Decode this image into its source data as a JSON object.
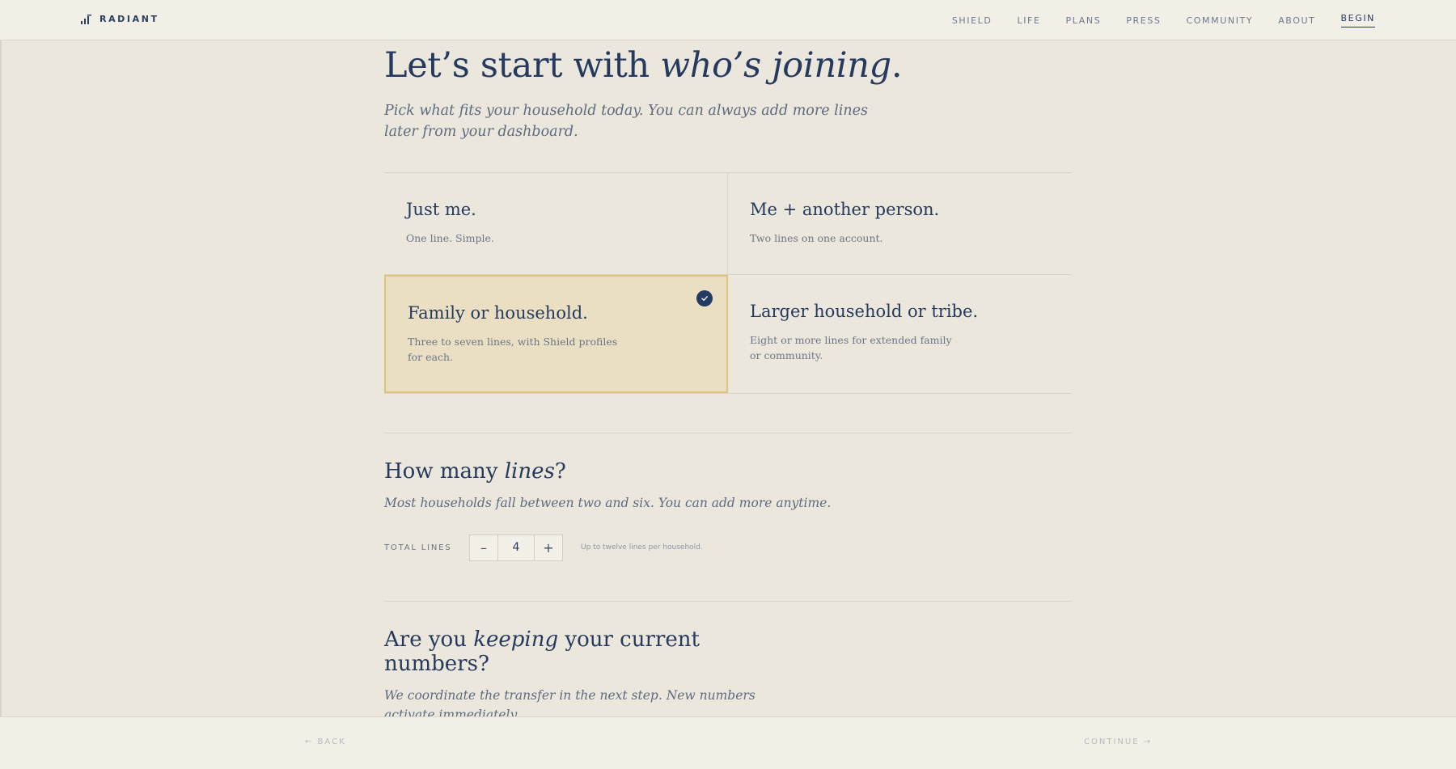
{
  "nav": {
    "brand": "RADIANT",
    "links": [
      "SHIELD",
      "LIFE",
      "PLANS",
      "PRESS",
      "COMMUNITY",
      "ABOUT"
    ],
    "begin": "BEGIN"
  },
  "hero": {
    "title_start": "Let’s start with ",
    "title_em": "who’s joining",
    "title_end": ".",
    "lede": "Pick what fits your household today. You can always add more lines later from your dashboard."
  },
  "options": [
    {
      "title": "Just me.",
      "desc": "One line. Simple.",
      "selected": false
    },
    {
      "title": "Me + another person.",
      "desc": "Two lines on one account.",
      "selected": false
    },
    {
      "title": "Family or household.",
      "desc": "Three to seven lines, with Shield profiles for each.",
      "selected": true
    },
    {
      "title": "Larger household or tribe.",
      "desc": "Eight or more lines for extended family or community.",
      "selected": false
    }
  ],
  "lines": {
    "title_start": "How many ",
    "title_em": "lines",
    "title_end": "?",
    "sub": "Most households fall between two and six. You can add more anytime.",
    "label": "TOTAL LINES",
    "minus": "–",
    "value": "4",
    "plus": "+",
    "note": "Up to twelve lines per household."
  },
  "numbers": {
    "title_start": "Are you ",
    "title_em": "keeping",
    "title_mid": " your current",
    "title_line2": "numbers?",
    "sub": "We coordinate the transfer in the next step. New numbers activate immediately."
  },
  "footer": {
    "back": "← BACK",
    "continue": "CONTINUE →"
  },
  "colors": {
    "background": "#ebe7dc",
    "navy": "#253a5e",
    "selected_fill": "#ebdfc3",
    "selected_border": "#e0c47a"
  },
  "icons": {
    "brand": "signal-bars-icon",
    "selected": "check-icon"
  }
}
